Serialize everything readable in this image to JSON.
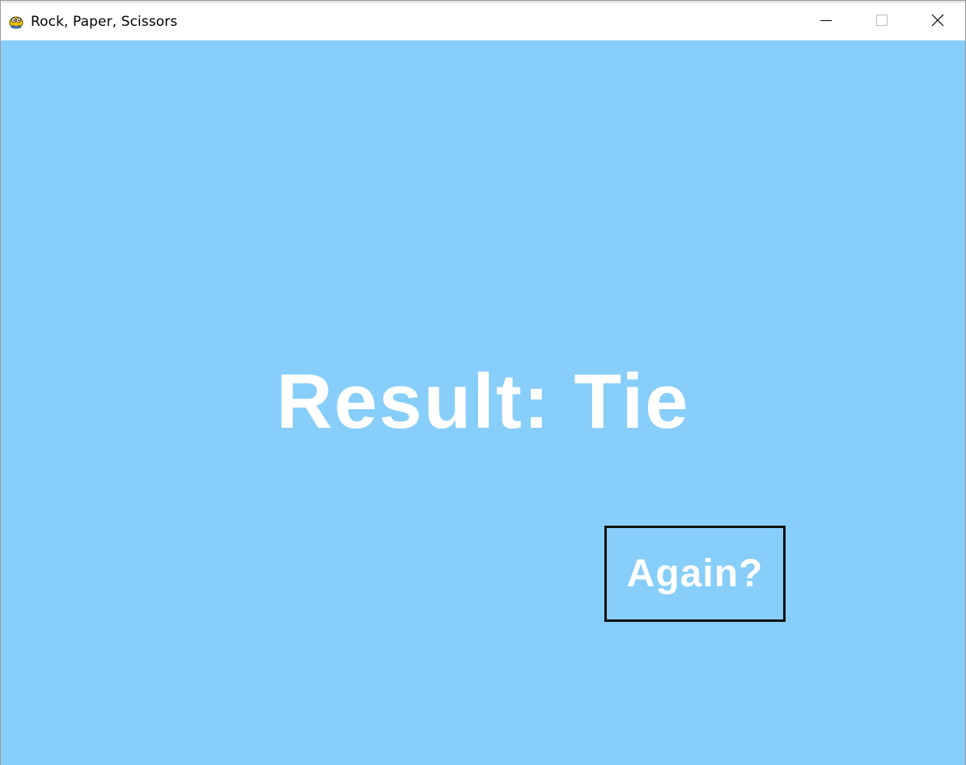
{
  "window": {
    "title": "Rock, Paper, Scissors",
    "icon": "python-snake-icon",
    "controls": [
      "minimize-icon",
      "maximize-icon",
      "close-icon"
    ]
  },
  "game": {
    "background_color": "#87cefa",
    "result_text": "Result: Tie",
    "again_label": "Again?",
    "text_color": "#ffffff",
    "button_border_color": "#111111"
  }
}
